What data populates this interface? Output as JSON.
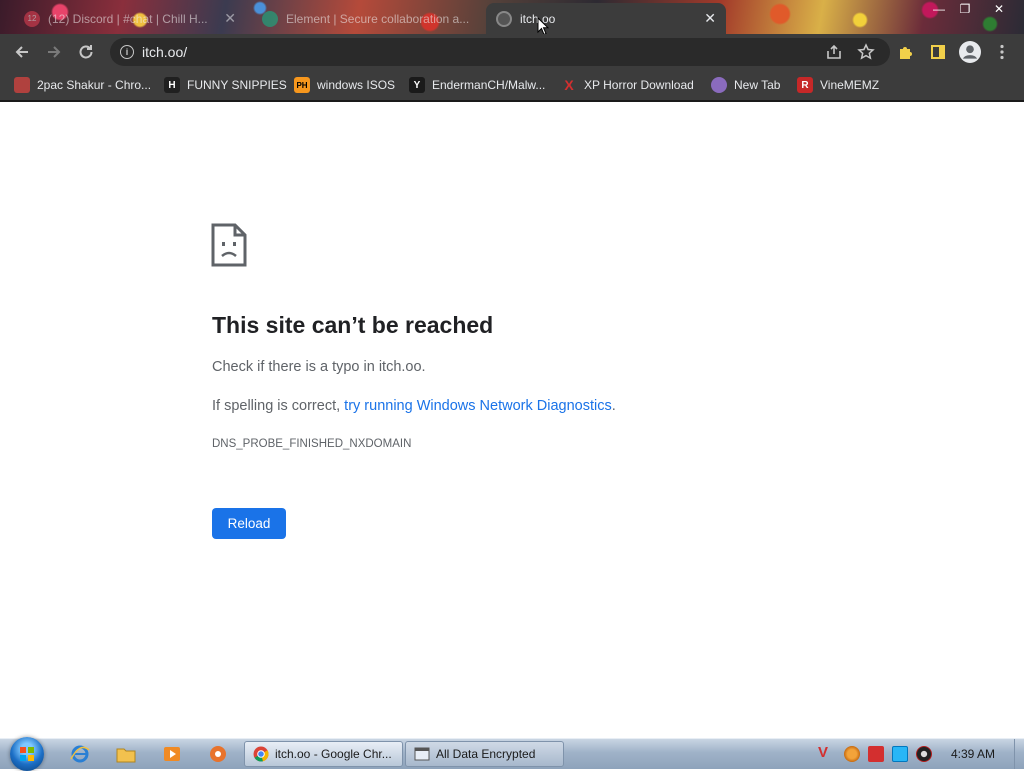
{
  "tabs": [
    {
      "title": "(12) Discord | #chat | Chill H...",
      "active": false,
      "favicon_color": "#e84255"
    },
    {
      "title": "Element | Secure collaboration a...",
      "active": false,
      "favicon_color": "#0dbd8b"
    },
    {
      "title": "itch.oo",
      "active": true,
      "favicon_color": "#777777"
    }
  ],
  "toolbar": {
    "url": "itch.oo/"
  },
  "bookmarks": [
    {
      "label": "2pac Shakur - Chro...",
      "icon": "2pac-icon",
      "icon_text": "",
      "color": "#b0413e"
    },
    {
      "label": "FUNNY SNIPPIES",
      "icon": "h-icon",
      "icon_text": "H",
      "color": "#202020"
    },
    {
      "label": "windows ISOS",
      "icon": "ph-icon",
      "icon_text": "PH",
      "color": "#f7971d"
    },
    {
      "label": "EndermanCH/Malw...",
      "icon": "yp-icon",
      "icon_text": "Y",
      "color": "#1a1a1a"
    },
    {
      "label": "XP Horror Download",
      "icon": "x-icon",
      "icon_text": "X",
      "color": "#d32f2f"
    },
    {
      "label": "New Tab",
      "icon": "newtab-icon",
      "icon_text": "",
      "color": "#8a6bbd"
    },
    {
      "label": "VineMEMZ",
      "icon": "r-icon",
      "icon_text": "R",
      "color": "#c62828"
    }
  ],
  "error": {
    "title": "This site can’t be reached",
    "line1": "Check if there is a typo in itch.oo.",
    "line2_prefix": "If spelling is correct, ",
    "line2_link": "try running Windows Network Diagnostics",
    "line2_suffix": ".",
    "code": "DNS_PROBE_FINISHED_NXDOMAIN",
    "reload_label": "Reload"
  },
  "taskbar": {
    "tasks": [
      {
        "label": "itch.oo - Google Chr...",
        "icon": "chrome-icon"
      },
      {
        "label": "All Data Encrypted",
        "icon": "window-icon"
      }
    ],
    "clock": "4:39 AM"
  },
  "colors": {
    "link": "#1a73e8",
    "button": "#1a73e8",
    "chrome_dark": "#3c3c3c"
  }
}
